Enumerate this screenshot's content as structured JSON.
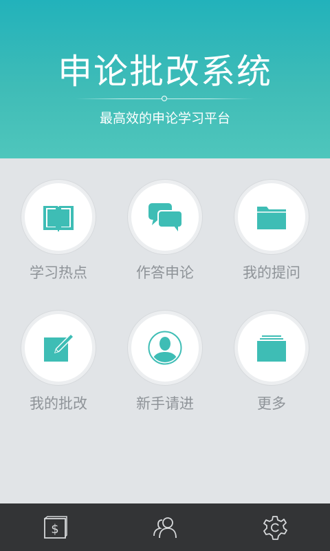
{
  "header": {
    "title": "申论批改系统",
    "subtitle": "最高效的申论学习平台"
  },
  "menu": [
    {
      "label": "学习热点",
      "icon": "open-book-icon"
    },
    {
      "label": "作答申论",
      "icon": "chat-bubbles-icon"
    },
    {
      "label": "我的提问",
      "icon": "folder-icon"
    },
    {
      "label": "我的批改",
      "icon": "edit-pencil-icon"
    },
    {
      "label": "新手请进",
      "icon": "user-profile-icon"
    },
    {
      "label": "更多",
      "icon": "stack-icon"
    }
  ],
  "bottom_nav": [
    {
      "icon": "dollar-wallet-icon"
    },
    {
      "icon": "users-icon"
    },
    {
      "icon": "settings-gear-icon"
    }
  ],
  "colors": {
    "accent": "#3ebdb5",
    "header_top": "#22b2bb",
    "header_bottom": "#4fc6bc",
    "background": "#e1e4e7",
    "label": "#8e9398",
    "bottom_bar": "#333436"
  }
}
